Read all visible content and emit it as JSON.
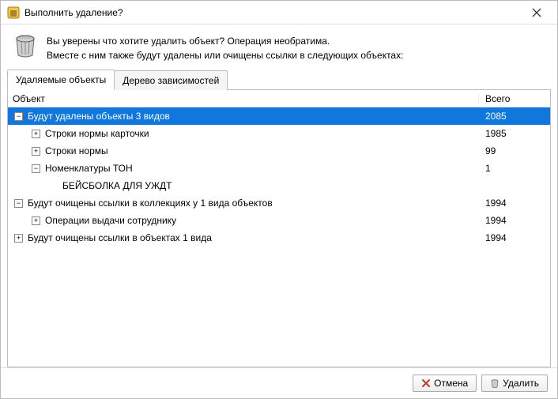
{
  "title": "Выполнить удаление?",
  "message_line1": "Вы уверены что хотите удалить объект? Операция необратима.",
  "message_line2": "Вместе с ним также будут удалены или очищены ссылки в следующих объектах:",
  "tabs": {
    "items": [
      {
        "label": "Удаляемые объекты",
        "active": true
      },
      {
        "label": "Дерево зависимостей",
        "active": false
      }
    ]
  },
  "columns": {
    "object": "Объект",
    "total": "Всего"
  },
  "rows": [
    {
      "indent": 0,
      "toggle": "-",
      "label": "Будут удалены объекты 3 видов",
      "count": "2085",
      "selected": true
    },
    {
      "indent": 1,
      "toggle": "+",
      "label": "Строки нормы карточки",
      "count": "1985"
    },
    {
      "indent": 1,
      "toggle": "+",
      "label": "Строки нормы",
      "count": "99"
    },
    {
      "indent": 1,
      "toggle": "-",
      "label": "Номенклатуры ТОН",
      "count": "1"
    },
    {
      "indent": 2,
      "toggle": "",
      "label": "БЕЙСБОЛКА ДЛЯ УЖДТ",
      "count": ""
    },
    {
      "indent": 0,
      "toggle": "-",
      "label": "Будут очищены ссылки в коллекциях у 1 вида объектов",
      "count": "1994"
    },
    {
      "indent": 1,
      "toggle": "+",
      "label": "Операции выдачи сотруднику",
      "count": "1994"
    },
    {
      "indent": 0,
      "toggle": "+",
      "label": "Будут очищены ссылки в объектах 1 вида",
      "count": "1994"
    }
  ],
  "buttons": {
    "cancel": "Отмена",
    "delete": "Удалить"
  }
}
